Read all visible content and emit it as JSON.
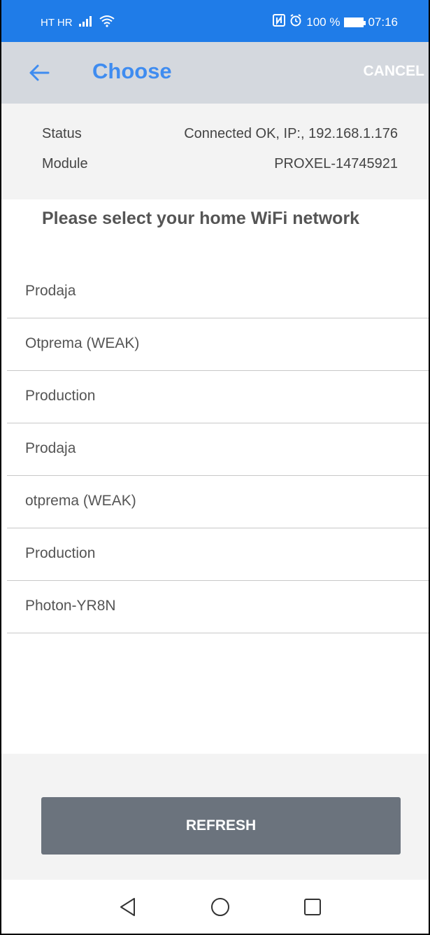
{
  "status_bar": {
    "carrier": "HT HR",
    "battery": "100 %",
    "time": "07:16",
    "icons": [
      "signal-icon",
      "wifi-icon",
      "nfc-icon",
      "alarm-icon",
      "battery-icon"
    ]
  },
  "app_bar": {
    "title": "Choose",
    "cancel_label": "CANCEL",
    "accent_color": "#3f8cf0"
  },
  "info": {
    "status_label": "Status",
    "status_value": "Connected OK, IP:, 192.168.1.176",
    "module_label": "Module",
    "module_value": "PROXEL-14745921"
  },
  "heading": "Please select your home WiFi network",
  "networks": [
    {
      "name": "Prodaja"
    },
    {
      "name": "Otprema (WEAK)"
    },
    {
      "name": "Production"
    },
    {
      "name": "Prodaja"
    },
    {
      "name": "otprema (WEAK)"
    },
    {
      "name": "Production"
    },
    {
      "name": "Photon-YR8N"
    }
  ],
  "refresh_label": "REFRESH",
  "nav": {
    "icons": [
      "back-triangle-icon",
      "home-circle-icon",
      "recents-square-icon"
    ]
  }
}
